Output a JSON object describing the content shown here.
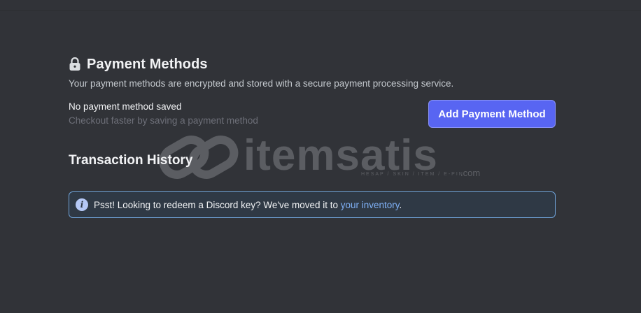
{
  "payment_methods": {
    "title": "Payment Methods",
    "description": "Your payment methods are encrypted and stored with a secure payment processing service.",
    "empty_title": "No payment method saved",
    "empty_subtitle": "Checkout faster by saving a payment method",
    "add_button_label": "Add Payment Method",
    "icon": "lock-icon"
  },
  "transaction_history": {
    "title": "Transaction History"
  },
  "notice": {
    "icon": "info-icon",
    "text": "Psst! Looking to redeem a Discord key? We've moved it to ",
    "link_text": "your inventory",
    "suffix": "."
  },
  "watermark": {
    "text": "itemsatis",
    "subtext": "HESAP / SKIN / ITEM / E-PIN",
    "suffix": ".com"
  },
  "colors": {
    "background": "#313338",
    "accent": "#5865f2",
    "link": "#7fb0f5",
    "notice_border": "#6ea1d6"
  }
}
